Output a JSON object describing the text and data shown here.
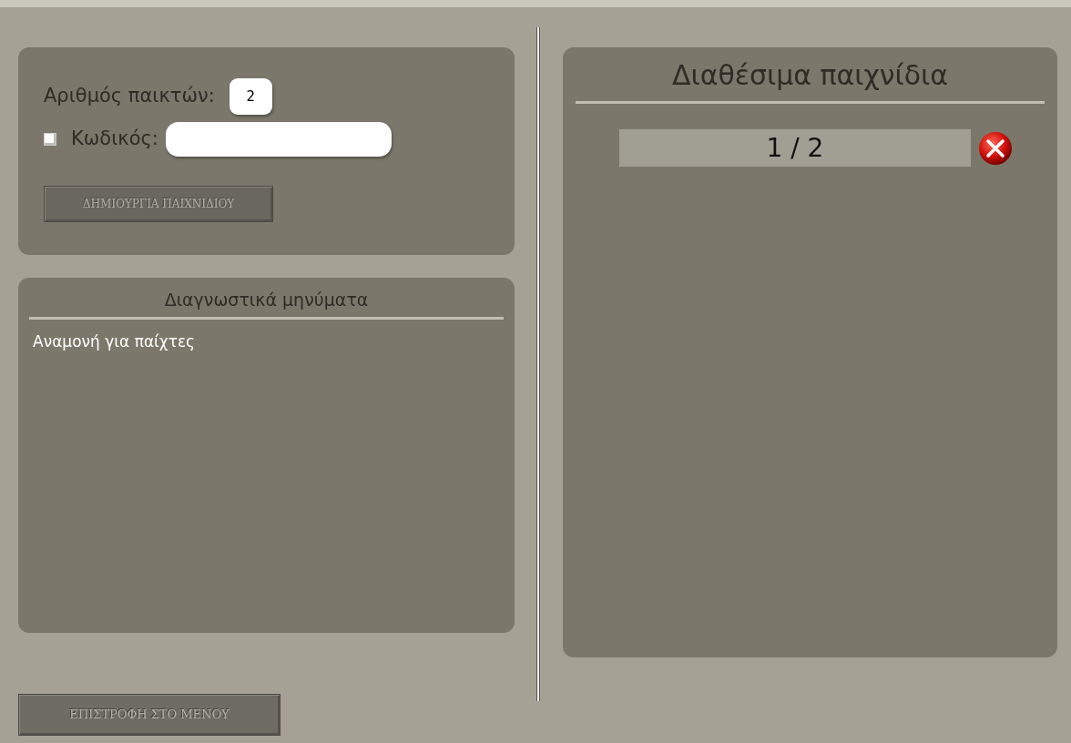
{
  "setup": {
    "players_label": "Αριθμός παικτών:",
    "players_value": "2",
    "password_checked": false,
    "password_label": "Κωδικός:",
    "create_button": {
      "label": "ΔΗΜΙΟΥΡΓΙΑ ΠΑΙΧΝΙΔΙΟΥ",
      "disabled": true
    }
  },
  "diagnostics": {
    "title": "Διαγνωστικά μηνύματα",
    "messages": [
      "Αναμονή για παίχτες"
    ]
  },
  "games": {
    "title": "Διαθέσιμα παιχνίδια",
    "items": [
      {
        "players": "1 / 2"
      }
    ]
  },
  "back_button": "ΕΠΙΣΤΡΟΦΗ ΣΤΟ ΜΕΝΟΥ"
}
